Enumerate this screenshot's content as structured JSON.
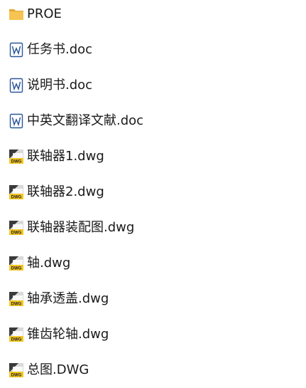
{
  "files": [
    {
      "name": "PROE",
      "type": "folder",
      "icon": "folder-icon"
    },
    {
      "name": "任务书.doc",
      "type": "doc",
      "icon": "word-doc-icon"
    },
    {
      "name": "说明书.doc",
      "type": "doc",
      "icon": "word-doc-icon"
    },
    {
      "name": "中英文翻译文献.doc",
      "type": "doc",
      "icon": "word-doc-icon"
    },
    {
      "name": "联轴器1.dwg",
      "type": "dwg",
      "icon": "dwg-file-icon"
    },
    {
      "name": "联轴器2.dwg",
      "type": "dwg",
      "icon": "dwg-file-icon"
    },
    {
      "name": "联轴器装配图.dwg",
      "type": "dwg",
      "icon": "dwg-file-icon"
    },
    {
      "name": "轴.dwg",
      "type": "dwg",
      "icon": "dwg-file-icon"
    },
    {
      "name": "轴承透盖.dwg",
      "type": "dwg",
      "icon": "dwg-file-icon"
    },
    {
      "name": "锥齿轮轴.dwg",
      "type": "dwg",
      "icon": "dwg-file-icon"
    },
    {
      "name": "总图.DWG",
      "type": "dwg",
      "icon": "dwg-file-icon"
    }
  ],
  "icon_labels": {
    "dwg": "DWG"
  },
  "colors": {
    "folder": "#f5c452",
    "folder_dark": "#e3a72f",
    "word_blue": "#2b579a",
    "dwg_yellow": "#f3c623",
    "dwg_gray": "#d9d9d9"
  }
}
